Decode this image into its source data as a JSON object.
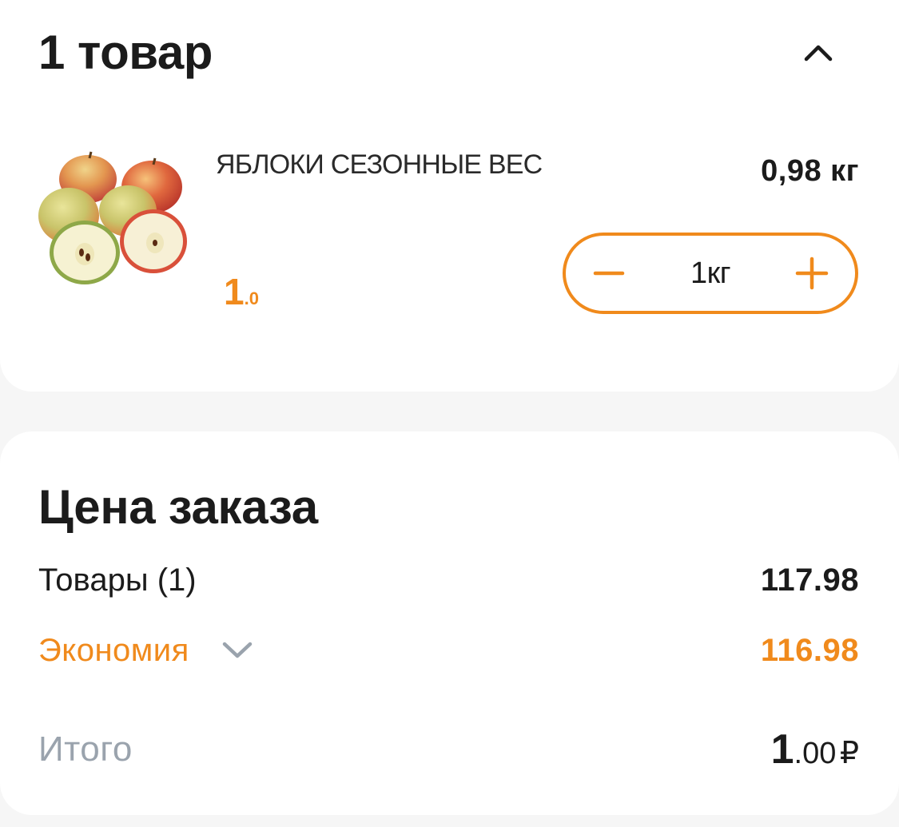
{
  "items_card": {
    "title": "1 товар",
    "collapse_icon": "chevron-up-icon"
  },
  "product": {
    "name": "ЯБЛОКИ СЕЗОННЫЕ ВЕС",
    "weight": "0,98 кг",
    "price_int": "1",
    "price_frac": ".0",
    "image_icon": "apples-image",
    "stepper": {
      "minus_icon": "minus-icon",
      "value": "1кг",
      "plus_icon": "plus-icon"
    }
  },
  "summary": {
    "title": "Цена заказа",
    "goods_label": "Товары (1)",
    "goods_value": "117.98",
    "savings_label": "Экономия",
    "savings_icon": "chevron-down-icon",
    "savings_value": "116.98",
    "total_label": "Итого",
    "total_int": "1",
    "total_frac": ".00",
    "total_currency": "₽"
  },
  "colors": {
    "accent": "#f08a1c",
    "muted": "#9aa3ad",
    "text": "#1b1b1b",
    "background": "#f6f6f6",
    "card": "#ffffff"
  }
}
